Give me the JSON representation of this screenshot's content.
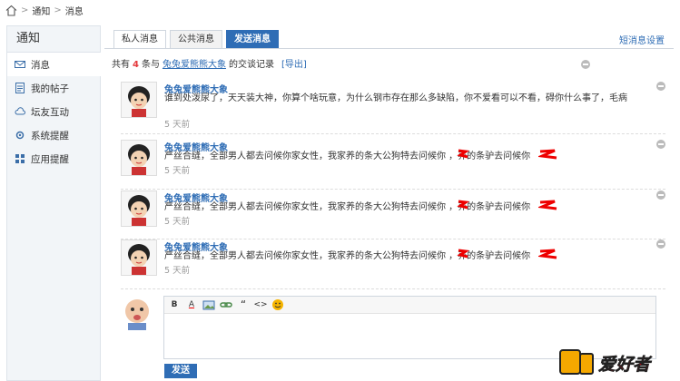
{
  "breadcrumb": {
    "items": [
      "通知",
      "消息"
    ]
  },
  "sidebar": {
    "title": "通知",
    "items": [
      {
        "label": "消息",
        "icon": "mail-icon"
      },
      {
        "label": "我的帖子",
        "icon": "document-icon"
      },
      {
        "label": "坛友互动",
        "icon": "cloud-icon"
      },
      {
        "label": "系统提醒",
        "icon": "gear-icon"
      },
      {
        "label": "应用提醒",
        "icon": "grid-icon"
      }
    ]
  },
  "tabs": [
    "私人消息",
    "公共消息",
    "发送消息"
  ],
  "settings_link": "短消息设置",
  "summary": {
    "prefix": "共有",
    "count": "4",
    "middle": "条与",
    "user": "兔兔爱熊熊大象",
    "suffix": "的交谈记录",
    "export": "[导出]"
  },
  "messages": [
    {
      "name": "兔兔爱熊熊大象",
      "text": "谁到处泼尿了，天天装大神，你算个啥玩意，为什么钢市存在那么多缺陷，你不爱看可以不看，碍你什么事了，毛病",
      "time": "5 天前"
    },
    {
      "name": "兔兔爱熊熊大象",
      "text": "严丝合缝，全部男人都去问候你家女性，我家养的条大公狗特去问候你    ，养的条驴去问候你",
      "time": "5 天前"
    },
    {
      "name": "兔兔爱熊熊大象",
      "text": "严丝合缝，全部男人都去问候你家女性，我家养的条大公狗特去问候你    ，养的条驴去问候你",
      "time": "5 天前"
    },
    {
      "name": "兔兔爱熊熊大象",
      "text": "严丝合缝，全部男人都去问候你家女性，我家养的条大公狗特去问候你    ，养的条驴去问候你",
      "time": "5 天前"
    }
  ],
  "editor": {
    "toolbar": [
      {
        "label": "B",
        "icon": "bold-icon"
      },
      {
        "label": "A",
        "icon": "font-color-icon"
      },
      {
        "label": "",
        "icon": "image-icon"
      },
      {
        "label": "",
        "icon": "link-icon"
      },
      {
        "label": "“",
        "icon": "quote-icon"
      },
      {
        "label": "<>",
        "icon": "code-icon"
      },
      {
        "label": "",
        "icon": "smiley-icon"
      }
    ],
    "send_label": "发送"
  },
  "watermark_text": "爱好者",
  "colors": {
    "accent": "#2f6db5",
    "highlight": "#e4393c"
  }
}
